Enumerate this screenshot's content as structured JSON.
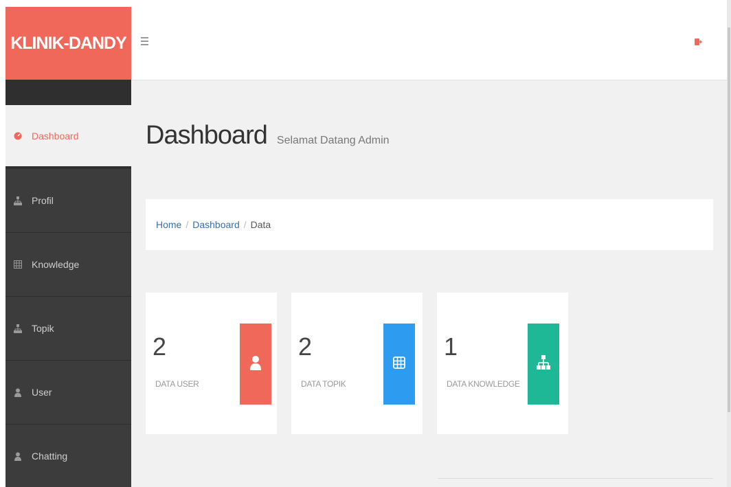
{
  "app": {
    "brand": "KLINIK-DANDY"
  },
  "topbar": {
    "menu_icon": "hamburger-icon",
    "logout_icon": "logout-icon"
  },
  "sidebar": {
    "items": [
      {
        "label": "Dashboard",
        "icon": "dashboard-icon",
        "active": true
      },
      {
        "label": "Profil",
        "icon": "sitemap-icon"
      },
      {
        "label": "Knowledge",
        "icon": "table-icon"
      },
      {
        "label": "Topik",
        "icon": "sitemap-icon"
      },
      {
        "label": "User",
        "icon": "user-icon"
      },
      {
        "label": "Chatting",
        "icon": "user-icon"
      }
    ]
  },
  "main": {
    "title": "Dashboard",
    "subtitle": "Selamat Datang Admin",
    "breadcrumb": [
      "Home",
      "Dashboard",
      "Data"
    ],
    "cards": [
      {
        "value": "2",
        "label": "DATA USER",
        "color": "#f0685a",
        "icon": "user-icon"
      },
      {
        "value": "2",
        "label": "DATA TOPIK",
        "color": "#2d9cf0",
        "icon": "table-icon"
      },
      {
        "value": "1",
        "label": "DATA KNOWLEDGE",
        "color": "#1fb896",
        "icon": "sitemap-icon"
      }
    ]
  },
  "colors": {
    "accent": "#f0685a",
    "sidebar": "#3c3c3c",
    "link": "#3a6fa5"
  }
}
